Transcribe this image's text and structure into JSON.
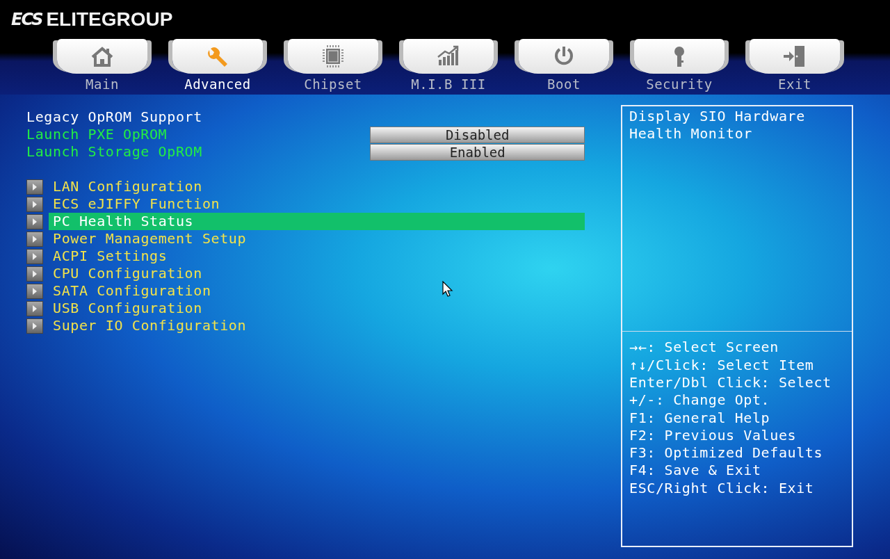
{
  "header": {
    "logo": "ECS",
    "brand": "ELITEGROUP"
  },
  "tabs": [
    {
      "label": "Main",
      "selected": false
    },
    {
      "label": "Advanced",
      "selected": true
    },
    {
      "label": "Chipset",
      "selected": false
    },
    {
      "label": "M.I.B III",
      "selected": false
    },
    {
      "label": "Boot",
      "selected": false
    },
    {
      "label": "Security",
      "selected": false
    },
    {
      "label": "Exit",
      "selected": false
    }
  ],
  "settings": [
    {
      "kind": "heading",
      "label": "Legacy OpROM Support"
    },
    {
      "kind": "option",
      "label": "Launch PXE OpROM",
      "value": "Disabled"
    },
    {
      "kind": "option",
      "label": "Launch Storage OpROM",
      "value": "Enabled"
    }
  ],
  "submenus": [
    {
      "label": "LAN Configuration",
      "selected": false
    },
    {
      "label": "ECS eJIFFY Function",
      "selected": false
    },
    {
      "label": "PC Health Status",
      "selected": true
    },
    {
      "label": "Power Management Setup",
      "selected": false
    },
    {
      "label": "ACPI Settings",
      "selected": false
    },
    {
      "label": "CPU Configuration",
      "selected": false
    },
    {
      "label": "SATA Configuration",
      "selected": false
    },
    {
      "label": "USB Configuration",
      "selected": false
    },
    {
      "label": "Super IO Configuration",
      "selected": false
    }
  ],
  "help": {
    "description": "Display SIO Hardware Health Monitor",
    "keys": [
      "→←: Select Screen",
      "↑↓/Click: Select Item",
      "Enter/Dbl Click: Select",
      "+/-: Change Opt.",
      "F1: General Help",
      "F2: Previous Values",
      "F3: Optimized Defaults",
      "F4: Save & Exit",
      "ESC/Right Click: Exit"
    ]
  }
}
